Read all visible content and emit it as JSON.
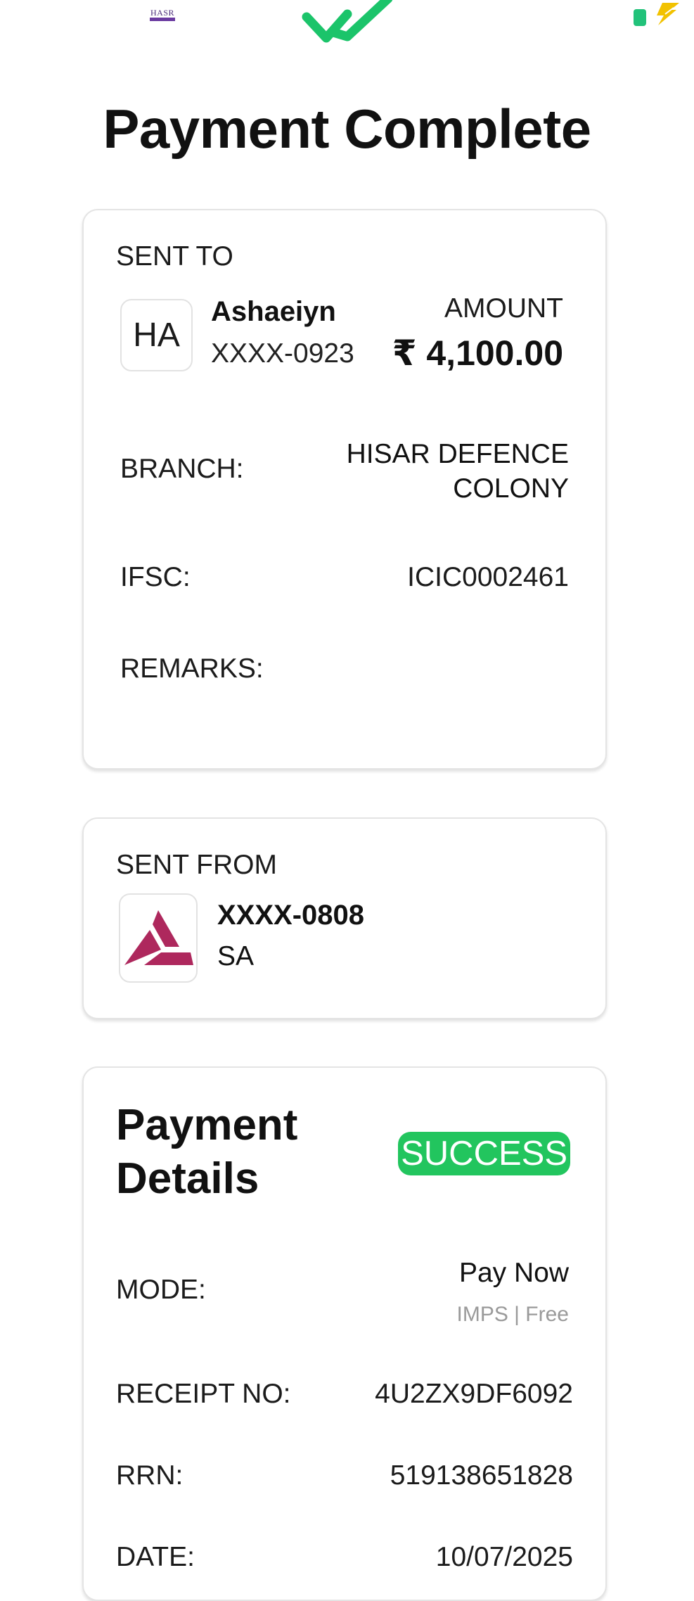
{
  "status_bar": {
    "logo_text": "HASR"
  },
  "header": {
    "title": "Payment Complete"
  },
  "sent_to": {
    "heading": "SENT TO",
    "avatar_initials": "HA",
    "name": "Ashaeiyn",
    "account": "XXXX-0923",
    "amount_label": "AMOUNT",
    "amount": "₹ 4,100.00",
    "branch_label": "BRANCH:",
    "branch_value": "HISAR DEFENCE COLONY",
    "ifsc_label": "IFSC:",
    "ifsc_value": "ICIC0002461",
    "remarks_label": "REMARKS:",
    "remarks_value": ""
  },
  "sent_from": {
    "heading": "SENT FROM",
    "bank_icon": "axis-bank-logo",
    "account": "XXXX-0808",
    "name": "SA"
  },
  "payment_details": {
    "title": "Payment Details",
    "status": "SUCCESS",
    "mode_label": "MODE:",
    "mode_value": "Pay Now",
    "mode_sub": "IMPS | Free",
    "receipt_label": "RECEIPT NO:",
    "receipt_value": "4U2ZX9DF6092",
    "rrn_label": "RRN:",
    "rrn_value": "519138651828",
    "date_label": "DATE:",
    "date_value": "10/07/2025"
  },
  "colors": {
    "success": "#22c55e",
    "check": "#1bc46a",
    "bank_brand": "#ae285d",
    "battery": "#22c27a",
    "bolt": "#f2c200"
  }
}
